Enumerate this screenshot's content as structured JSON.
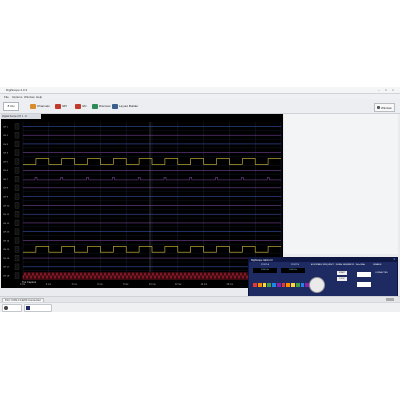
{
  "app": {
    "title": "DigiScope 2.0.3"
  },
  "menu": {
    "items": [
      "File",
      "Options",
      "Window",
      "Help"
    ]
  },
  "toolbar": {
    "ch_field": "8 CH",
    "buttons": [
      {
        "label": "Channels",
        "color": "#d98c2c"
      },
      {
        "label": "SPI",
        "color": "#c0392b"
      },
      {
        "label": "I2C",
        "color": "#c0392b"
      },
      {
        "label": "Discover",
        "color": "#2e8b57"
      },
      {
        "label": "Layout Builder",
        "color": "#3a5f8c"
      }
    ],
    "right_button": "Window"
  },
  "scope": {
    "tab": "Digital Scope CH 1 - 8",
    "channels": [
      "CH 1",
      "CH 2",
      "CH 3",
      "CH 4",
      "CH 5",
      "CH 6",
      "CH 7",
      "CH 8",
      "CH 9",
      "CH 10",
      "CH 11",
      "CH 12",
      "CH 13",
      "CH 14",
      "CH 15",
      "CH 16",
      "CH 17",
      "CH 18"
    ],
    "time_labels": [
      "0 ms",
      "2 ms",
      "4 ms",
      "6 ms",
      "8 ms",
      "10 ms",
      "12 ms",
      "14 ms",
      "16 ms",
      "18 ms",
      "20 ms"
    ],
    "bottom_note": "Tus Capture",
    "colors": {
      "grid": "#1b2a44",
      "trace_yellow": "#d9c23a",
      "trace_blue": "#3f5fc8",
      "trace_purple": "#8a4fb4",
      "trace_red": "#c6283a"
    }
  },
  "generator": {
    "title": "DigiScope GEN 2.0",
    "port_a": "PORT A",
    "port_b": "PORT B",
    "banner": "ADJUSTABLE FREQUENCY · SIGNAL GENERATOR · 1kHz-5MHz",
    "disable": "DISABLE",
    "connected": "CONNECTED",
    "freq_a": "1000 Hz",
    "freq_b": "1000 Hz",
    "start": "START",
    "stop": "STOP"
  },
  "statusbar": {
    "left": "Port: COM 4  19200  Connected"
  },
  "taskbar": {
    "items": [
      "",
      ""
    ]
  }
}
